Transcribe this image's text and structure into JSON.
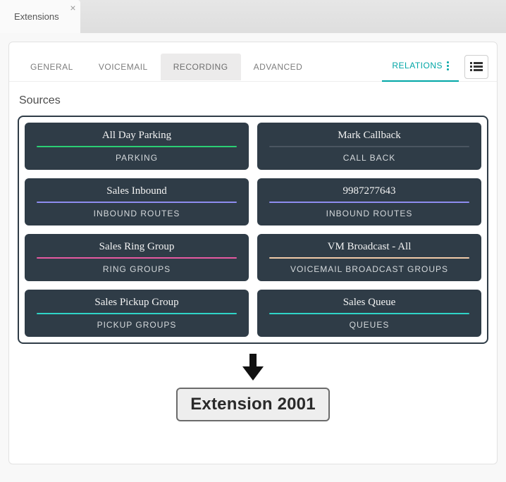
{
  "appTab": {
    "label": "Extensions"
  },
  "tabs": {
    "general": "GENERAL",
    "voicemail": "VOICEMAIL",
    "recording": "RECORDING",
    "advanced": "ADVANCED",
    "relations": "RELATIONS"
  },
  "sections": {
    "sources": "Sources"
  },
  "sources": [
    {
      "title": "All Day Parking",
      "type": "PARKING",
      "accent": "parking"
    },
    {
      "title": "Mark Callback",
      "type": "CALL BACK",
      "accent": "callback"
    },
    {
      "title": "Sales Inbound",
      "type": "INBOUND ROUTES",
      "accent": "inbound"
    },
    {
      "title": "9987277643",
      "type": "INBOUND ROUTES",
      "accent": "inbound"
    },
    {
      "title": "Sales Ring Group",
      "type": "RING GROUPS",
      "accent": "ring"
    },
    {
      "title": "VM Broadcast - All",
      "type": "VOICEMAIL BROADCAST GROUPS",
      "accent": "vmbcast"
    },
    {
      "title": "Sales Pickup Group",
      "type": "PICKUP GROUPS",
      "accent": "pickup"
    },
    {
      "title": "Sales Queue",
      "type": "QUEUES",
      "accent": "queues"
    }
  ],
  "target": {
    "label": "Extension 2001"
  }
}
